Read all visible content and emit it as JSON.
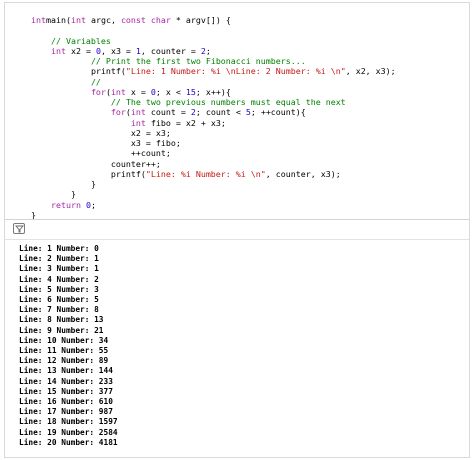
{
  "editor": {
    "lines": [
      {
        "indent": "    ",
        "segments": [
          [
            "kw",
            "int"
          ],
          [
            "",
            "main("
          ],
          [
            "kw",
            "int"
          ],
          [
            "",
            " argc, "
          ],
          [
            "kw",
            "const"
          ],
          [
            "",
            ""
          ],
          [
            "kw",
            " char"
          ],
          [
            "",
            " * argv[]) {"
          ]
        ]
      },
      {
        "indent": "",
        "segments": []
      },
      {
        "indent": "        ",
        "segments": [
          [
            "cm",
            "// Variables"
          ]
        ]
      },
      {
        "indent": "        ",
        "segments": [
          [
            "kw",
            "int"
          ],
          [
            "",
            " x2 = "
          ],
          [
            "nm",
            "0"
          ],
          [
            "",
            ", x3 = "
          ],
          [
            "nm",
            "1"
          ],
          [
            "",
            ", counter = "
          ],
          [
            "nm",
            "2"
          ],
          [
            "",
            ";"
          ]
        ]
      },
      {
        "indent": "                ",
        "segments": [
          [
            "cm",
            "// Print the first two Fibonacci numbers..."
          ]
        ]
      },
      {
        "indent": "                ",
        "segments": [
          [
            "",
            "printf("
          ],
          [
            "st",
            "\"Line: 1 Number: %i \\nLine: 2 Number: %i \\n\""
          ],
          [
            "",
            ", x2, x3);"
          ]
        ]
      },
      {
        "indent": "                ",
        "segments": [
          [
            "cm",
            "//"
          ]
        ]
      },
      {
        "indent": "                ",
        "segments": [
          [
            "kw",
            "for"
          ],
          [
            "",
            "("
          ],
          [
            "kw",
            "int"
          ],
          [
            "",
            " x = "
          ],
          [
            "nm",
            "0"
          ],
          [
            "",
            "; x < "
          ],
          [
            "nm",
            "15"
          ],
          [
            "",
            "; x++){"
          ]
        ]
      },
      {
        "indent": "                    ",
        "segments": [
          [
            "cm",
            "// The two previous numbers must equal the next"
          ]
        ]
      },
      {
        "indent": "                    ",
        "segments": [
          [
            "kw",
            "for"
          ],
          [
            "",
            "("
          ],
          [
            "kw",
            "int"
          ],
          [
            "",
            " count = "
          ],
          [
            "nm",
            "2"
          ],
          [
            "",
            "; count < "
          ],
          [
            "nm",
            "5"
          ],
          [
            "",
            "; ++count){"
          ]
        ]
      },
      {
        "indent": "                        ",
        "segments": [
          [
            "kw",
            "int"
          ],
          [
            "",
            " fibo = x2 + x3;"
          ]
        ]
      },
      {
        "indent": "                        ",
        "segments": [
          [
            "",
            "x2 = x3;"
          ]
        ]
      },
      {
        "indent": "                        ",
        "segments": [
          [
            "",
            "x3 = fibo;"
          ]
        ]
      },
      {
        "indent": "                        ",
        "segments": [
          [
            "",
            "++count;"
          ]
        ]
      },
      {
        "indent": "                    ",
        "segments": [
          [
            "",
            "counter++;"
          ]
        ]
      },
      {
        "indent": "                    ",
        "segments": [
          [
            "",
            "printf("
          ],
          [
            "st",
            "\"Line: %i Number: %i \\n\""
          ],
          [
            "",
            ", counter, x3);"
          ]
        ]
      },
      {
        "indent": "                ",
        "segments": [
          [
            "",
            "}"
          ]
        ]
      },
      {
        "indent": "            ",
        "segments": [
          [
            "",
            "}"
          ]
        ]
      },
      {
        "indent": "        ",
        "segments": [
          [
            "kw",
            "return"
          ],
          [
            "",
            " "
          ],
          [
            "nm",
            "0"
          ],
          [
            "",
            ";"
          ]
        ]
      },
      {
        "indent": "    ",
        "segments": [
          [
            "",
            "}"
          ]
        ]
      }
    ]
  },
  "console": {
    "filter_icon": "filter-icon",
    "lines": [
      "Line: 1 Number: 0",
      "Line: 2 Number: 1",
      "Line: 3 Number: 1",
      "Line: 4 Number: 2",
      "Line: 5 Number: 3",
      "Line: 6 Number: 5",
      "Line: 7 Number: 8",
      "Line: 8 Number: 13",
      "Line: 9 Number: 21",
      "Line: 10 Number: 34",
      "Line: 11 Number: 55",
      "Line: 12 Number: 89",
      "Line: 13 Number: 144",
      "Line: 14 Number: 233",
      "Line: 15 Number: 377",
      "Line: 16 Number: 610",
      "Line: 17 Number: 987",
      "Line: 18 Number: 1597",
      "Line: 19 Number: 2584",
      "Line: 20 Number: 4181"
    ]
  },
  "colors": {
    "keyword": "#a626a4",
    "comment": "#008000",
    "string": "#c41a16",
    "number": "#1c00cf"
  }
}
